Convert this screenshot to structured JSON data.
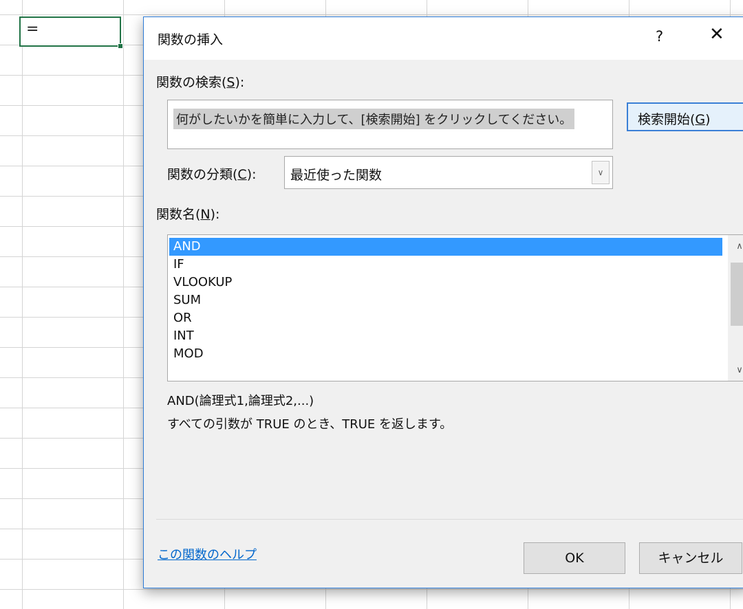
{
  "spreadsheet": {
    "active_cell_content": "="
  },
  "dialog": {
    "title": "関数の挿入",
    "help_symbol": "?",
    "close_symbol": "✕",
    "search": {
      "label_prefix": "関数の検索(",
      "label_key": "S",
      "label_suffix": "):",
      "input_value": "何がしたいかを簡単に入力して、[検索開始] をクリックしてください。",
      "button_prefix": "検索開始(",
      "button_key": "G",
      "button_suffix": ")"
    },
    "category": {
      "label_prefix": "関数の分類(",
      "label_key": "C",
      "label_suffix": "):",
      "selected": "最近使った関数",
      "arrow_icon": "chevron-down-icon"
    },
    "function_list": {
      "label_prefix": "関数名(",
      "label_key": "N",
      "label_suffix": "):",
      "items": [
        "AND",
        "IF",
        "VLOOKUP",
        "SUM",
        "OR",
        "INT",
        "MOD"
      ],
      "selected_index": 0
    },
    "syntax": "AND(論理式1,論理式2,...)",
    "description": "すべての引数が TRUE のとき、TRUE を返します。",
    "help_link": "この関数のヘルプ",
    "ok_label": "OK",
    "cancel_label": "キャンセル"
  },
  "colors": {
    "selection": "#3399ff",
    "dialog_border": "#2b7ad6",
    "cell_border": "#217346",
    "link": "#0066cc"
  }
}
